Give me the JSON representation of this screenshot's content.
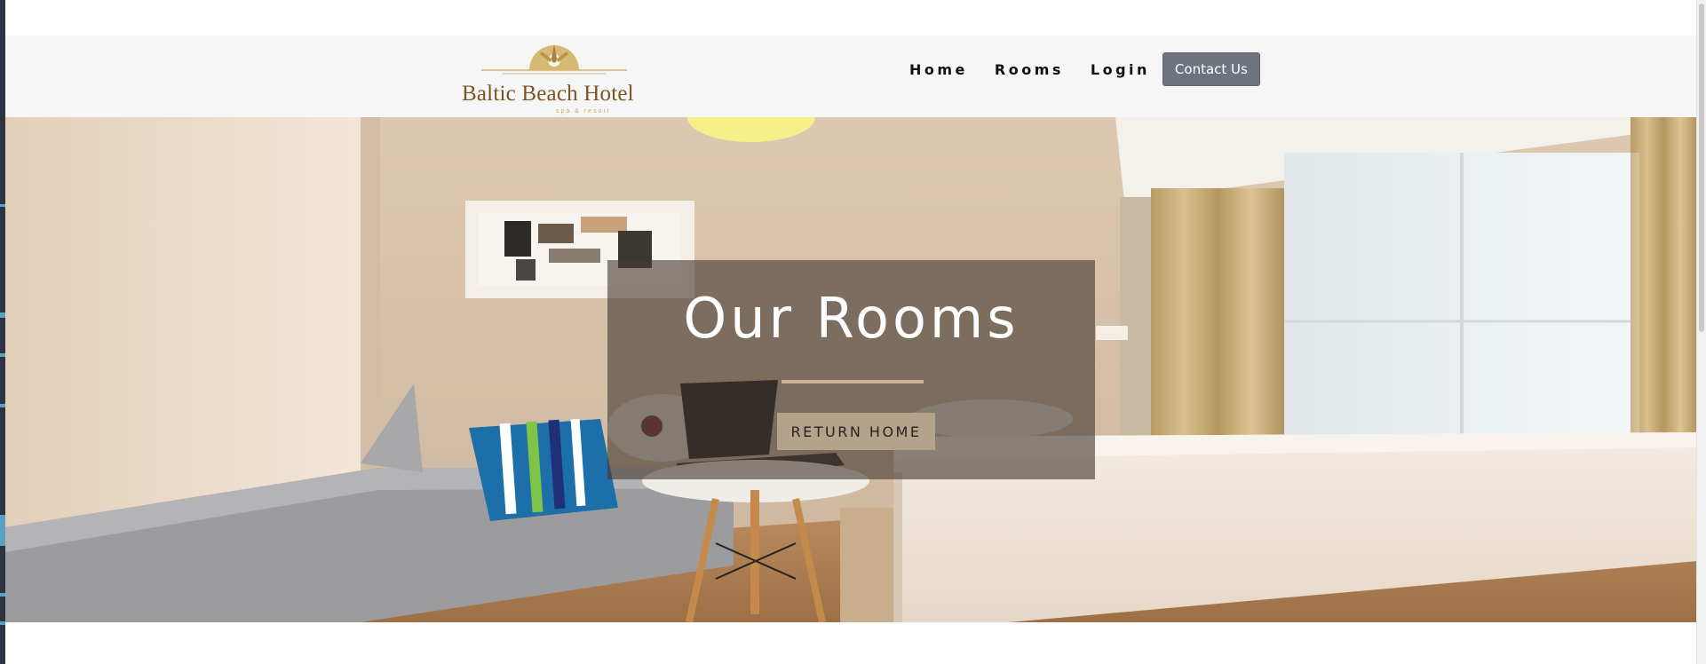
{
  "brand": {
    "name": "Baltic Beach Hotel",
    "tagline": "spa & resort"
  },
  "nav": {
    "items": [
      {
        "label": "Home"
      },
      {
        "label": "Rooms"
      },
      {
        "label": "Login"
      }
    ],
    "contact_label": "Contact Us"
  },
  "hero": {
    "title": "Our Rooms",
    "button_label": "RETURN HOME",
    "background": "hotel-room-photo"
  },
  "colors": {
    "brand_gold": "#c9a75a",
    "brand_brown": "#7a5521",
    "contact_button_bg": "#6d747e",
    "hero_button_bg": "#b4a28a",
    "navbar_bg": "#f6f6f6"
  }
}
